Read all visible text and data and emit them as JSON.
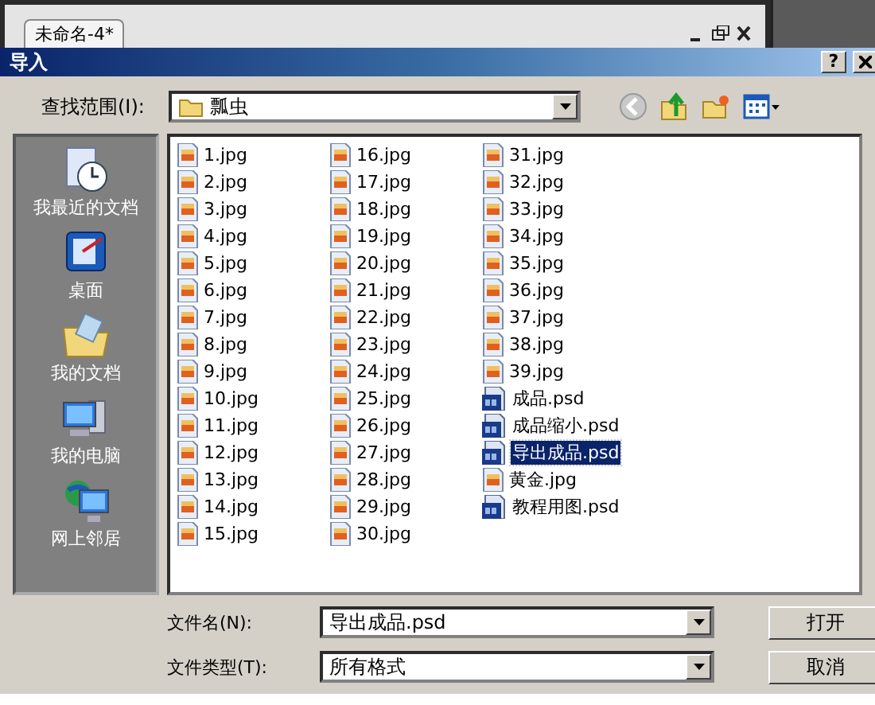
{
  "background_app": {
    "tab": "未命名-4*"
  },
  "dialog": {
    "title": "导入",
    "help": "?",
    "look_in": {
      "label": "查找范围(I):",
      "value": "瓢虫"
    },
    "places": [
      {
        "label": "我最近的文档",
        "kind": "recent"
      },
      {
        "label": "桌面",
        "kind": "desktop"
      },
      {
        "label": "我的文档",
        "kind": "documents"
      },
      {
        "label": "我的电脑",
        "kind": "computer"
      },
      {
        "label": "网上邻居",
        "kind": "network"
      }
    ],
    "files": [
      {
        "name": "1.jpg",
        "kind": "jpg",
        "selected": false
      },
      {
        "name": "2.jpg",
        "kind": "jpg",
        "selected": false
      },
      {
        "name": "3.jpg",
        "kind": "jpg",
        "selected": false
      },
      {
        "name": "4.jpg",
        "kind": "jpg",
        "selected": false
      },
      {
        "name": "5.jpg",
        "kind": "jpg",
        "selected": false
      },
      {
        "name": "6.jpg",
        "kind": "jpg",
        "selected": false
      },
      {
        "name": "7.jpg",
        "kind": "jpg",
        "selected": false
      },
      {
        "name": "8.jpg",
        "kind": "jpg",
        "selected": false
      },
      {
        "name": "9.jpg",
        "kind": "jpg",
        "selected": false
      },
      {
        "name": "10.jpg",
        "kind": "jpg",
        "selected": false
      },
      {
        "name": "11.jpg",
        "kind": "jpg",
        "selected": false
      },
      {
        "name": "12.jpg",
        "kind": "jpg",
        "selected": false
      },
      {
        "name": "13.jpg",
        "kind": "jpg",
        "selected": false
      },
      {
        "name": "14.jpg",
        "kind": "jpg",
        "selected": false
      },
      {
        "name": "15.jpg",
        "kind": "jpg",
        "selected": false
      },
      {
        "name": "16.jpg",
        "kind": "jpg",
        "selected": false
      },
      {
        "name": "17.jpg",
        "kind": "jpg",
        "selected": false
      },
      {
        "name": "18.jpg",
        "kind": "jpg",
        "selected": false
      },
      {
        "name": "19.jpg",
        "kind": "jpg",
        "selected": false
      },
      {
        "name": "20.jpg",
        "kind": "jpg",
        "selected": false
      },
      {
        "name": "21.jpg",
        "kind": "jpg",
        "selected": false
      },
      {
        "name": "22.jpg",
        "kind": "jpg",
        "selected": false
      },
      {
        "name": "23.jpg",
        "kind": "jpg",
        "selected": false
      },
      {
        "name": "24.jpg",
        "kind": "jpg",
        "selected": false
      },
      {
        "name": "25.jpg",
        "kind": "jpg",
        "selected": false
      },
      {
        "name": "26.jpg",
        "kind": "jpg",
        "selected": false
      },
      {
        "name": "27.jpg",
        "kind": "jpg",
        "selected": false
      },
      {
        "name": "28.jpg",
        "kind": "jpg",
        "selected": false
      },
      {
        "name": "29.jpg",
        "kind": "jpg",
        "selected": false
      },
      {
        "name": "30.jpg",
        "kind": "jpg",
        "selected": false
      },
      {
        "name": "31.jpg",
        "kind": "jpg",
        "selected": false
      },
      {
        "name": "32.jpg",
        "kind": "jpg",
        "selected": false
      },
      {
        "name": "33.jpg",
        "kind": "jpg",
        "selected": false
      },
      {
        "name": "34.jpg",
        "kind": "jpg",
        "selected": false
      },
      {
        "name": "35.jpg",
        "kind": "jpg",
        "selected": false
      },
      {
        "name": "36.jpg",
        "kind": "jpg",
        "selected": false
      },
      {
        "name": "37.jpg",
        "kind": "jpg",
        "selected": false
      },
      {
        "name": "38.jpg",
        "kind": "jpg",
        "selected": false
      },
      {
        "name": "39.jpg",
        "kind": "jpg",
        "selected": false
      },
      {
        "name": "成品.psd",
        "kind": "psd",
        "selected": false
      },
      {
        "name": "成品缩小.psd",
        "kind": "psd",
        "selected": false
      },
      {
        "name": "导出成品.psd",
        "kind": "psd",
        "selected": true
      },
      {
        "name": "黄金.jpg",
        "kind": "jpg",
        "selected": false
      },
      {
        "name": "教程用图.psd",
        "kind": "psd",
        "selected": false
      }
    ],
    "file_name": {
      "label": "文件名(N):",
      "value": "导出成品.psd"
    },
    "file_type": {
      "label": "文件类型(T):",
      "value": "所有格式"
    },
    "buttons": [
      "打开",
      "取消"
    ]
  }
}
